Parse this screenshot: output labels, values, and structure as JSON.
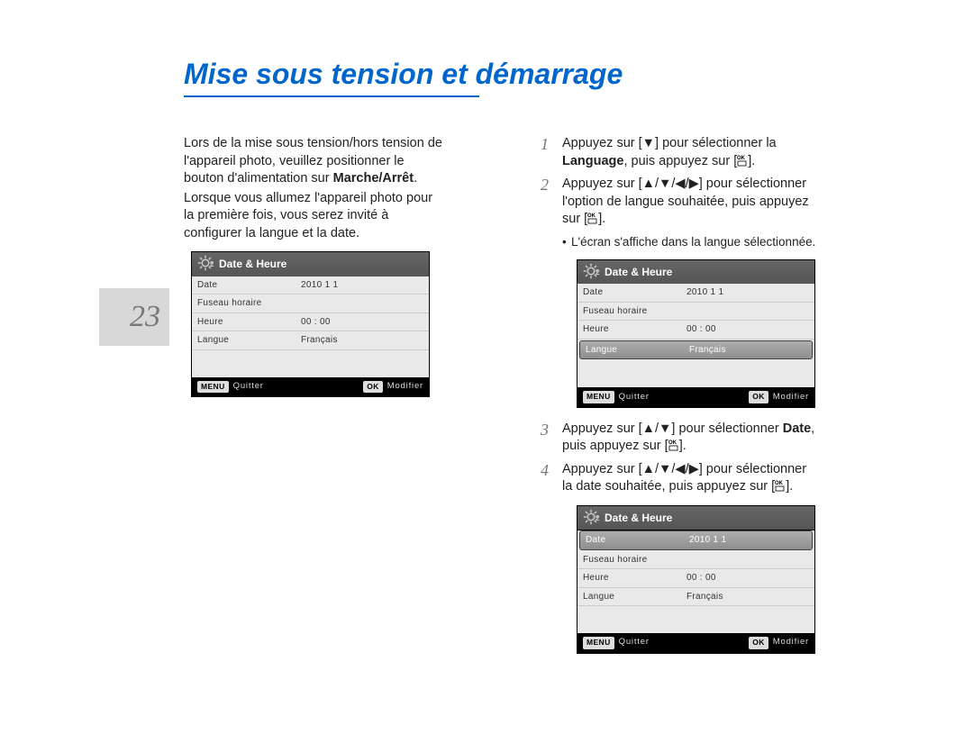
{
  "title": "Mise sous tension et démarrage",
  "page_number": "23",
  "left_para_1a": "Lors de la mise sous tension/hors tension de l'appareil photo, veuillez positionner le bouton d'alimentation sur ",
  "left_para_1b": "Marche/Arrêt",
  "left_para_1c": ".",
  "left_para_2": "Lorsque vous allumez l'appareil photo pour la première fois, vous serez invité à configurer la langue et la date.",
  "lcd": {
    "title": "Date & Heure",
    "rows": [
      {
        "label": "Date",
        "value": "2010   1   1"
      },
      {
        "label": "Fuseau horaire",
        "value": ""
      },
      {
        "label": "Heure",
        "value": "00 : 00"
      },
      {
        "label": "Langue",
        "value": "Français"
      }
    ],
    "footer_menu": "MENU",
    "footer_quitter": "Quitter",
    "footer_ok": "OK",
    "footer_modifier": "Modifier"
  },
  "steps": {
    "s1": {
      "num": "1",
      "a": "Appuyez sur [▼] pour sélectionner la ",
      "b": "Language",
      "c": ", puis appuyez sur [",
      "d": "]."
    },
    "s2": {
      "num": "2",
      "a": "Appuyez sur [▲/▼/◀/▶] pour sélectionner l'option de langue souhaitée, puis appuyez sur [",
      "b": "]."
    },
    "bullet": "L'écran s'affiche dans la langue sélectionnée.",
    "s3": {
      "num": "3",
      "a": "Appuyez sur [▲/▼] pour sélectionner ",
      "b": "Date",
      "c": ", puis appuyez sur [",
      "d": "]."
    },
    "s4": {
      "num": "4",
      "a": "Appuyez sur [▲/▼/◀/▶] pour sélectionner la date souhaitée, puis appuyez sur [",
      "b": "]."
    }
  },
  "ok_icon_text": "OK",
  "highlight_lcd2_row": 3,
  "highlight_lcd3_row": 0
}
